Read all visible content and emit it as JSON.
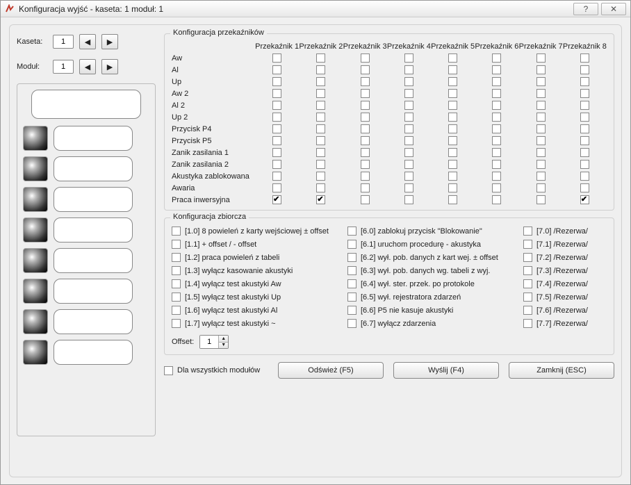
{
  "window": {
    "title": "Konfiguracja wyjść - kaseta: 1 moduł: 1"
  },
  "selectors": {
    "kaseta_label": "Kaseta:",
    "kaseta_value": "1",
    "modul_label": "Moduł:",
    "modul_value": "1"
  },
  "relay_group_title": "Konfiguracja przekaźników",
  "relay_headers": [
    "Przekaźnik 1",
    "Przekaźnik 2",
    "Przekaźnik 3",
    "Przekaźnik 4",
    "Przekaźnik 5",
    "Przekaźnik 6",
    "Przekaźnik 7",
    "Przekaźnik 8"
  ],
  "relay_rows": [
    {
      "label": "Aw",
      "checks": [
        false,
        false,
        false,
        false,
        false,
        false,
        false,
        false
      ]
    },
    {
      "label": "Al",
      "checks": [
        false,
        false,
        false,
        false,
        false,
        false,
        false,
        false
      ]
    },
    {
      "label": "Up",
      "checks": [
        false,
        false,
        false,
        false,
        false,
        false,
        false,
        false
      ]
    },
    {
      "label": "Aw 2",
      "checks": [
        false,
        false,
        false,
        false,
        false,
        false,
        false,
        false
      ]
    },
    {
      "label": "Al 2",
      "checks": [
        false,
        false,
        false,
        false,
        false,
        false,
        false,
        false
      ]
    },
    {
      "label": "Up 2",
      "checks": [
        false,
        false,
        false,
        false,
        false,
        false,
        false,
        false
      ]
    },
    {
      "label": "Przycisk P4",
      "checks": [
        false,
        false,
        false,
        false,
        false,
        false,
        false,
        false
      ]
    },
    {
      "label": "Przycisk P5",
      "checks": [
        false,
        false,
        false,
        false,
        false,
        false,
        false,
        false
      ]
    },
    {
      "label": "Zanik zasilania 1",
      "checks": [
        false,
        false,
        false,
        false,
        false,
        false,
        false,
        false
      ]
    },
    {
      "label": "Zanik zasilania 2",
      "checks": [
        false,
        false,
        false,
        false,
        false,
        false,
        false,
        false
      ]
    },
    {
      "label": "Akustyka zablokowana",
      "checks": [
        false,
        false,
        false,
        false,
        false,
        false,
        false,
        false
      ]
    },
    {
      "label": "Awaria",
      "checks": [
        false,
        false,
        false,
        false,
        false,
        false,
        false,
        false
      ]
    },
    {
      "label": "Praca inwersyjna",
      "checks": [
        true,
        true,
        false,
        false,
        false,
        false,
        false,
        true
      ]
    }
  ],
  "bulk_group_title": "Konfiguracja zbiorcza",
  "bulk_col1": [
    "[1.0] 8 powieleń z karty wejściowej ± offset",
    "[1.1] + offset / - offset",
    "[1.2] praca powieleń z tabeli",
    "[1.3] wyłącz kasowanie akustyki",
    "[1.4] wyłącz test akustyki Aw",
    "[1.5] wyłącz test akustyki Up",
    "[1.6] wyłącz test akustyki Al",
    "[1.7] wyłącz test akustyki ~"
  ],
  "bulk_col2": [
    "[6.0] zablokuj przycisk \"Blokowanie\"",
    "[6.1] uruchom procedurę - akustyka",
    "[6.2] wył. pob. danych z kart wej. ± offset",
    "[6.3] wył. pob. danych wg. tabeli z wyj.",
    "[6.4] wył. ster. przek. po protokole",
    "[6.5] wył. rejestratora zdarzeń",
    "[6.6] P5 nie kasuje akustyki",
    "[6.7] wyłącz zdarzenia"
  ],
  "bulk_col3": [
    "[7.0] /Rezerwa/",
    "[7.1] /Rezerwa/",
    "[7.2] /Rezerwa/",
    "[7.3] /Rezerwa/",
    "[7.4] /Rezerwa/",
    "[7.5] /Rezerwa/",
    "[7.6] /Rezerwa/",
    "[7.7] /Rezerwa/"
  ],
  "offset_label": "Offset:",
  "offset_value": "1",
  "all_modules_label": "Dla wszystkich modułów",
  "buttons": {
    "refresh": "Odśwież  (F5)",
    "send": "Wyślij  (F4)",
    "close": "Zamknij  (ESC)"
  }
}
